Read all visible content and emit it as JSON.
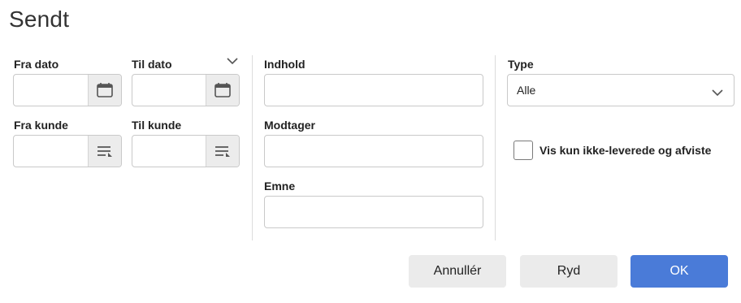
{
  "dialog": {
    "title": "Sendt"
  },
  "filters": {
    "from_date": {
      "label": "Fra dato",
      "value": "",
      "icon": "calendar-icon"
    },
    "to_date": {
      "label": "Til dato",
      "value": "",
      "icon": "calendar-icon"
    },
    "from_customer": {
      "label": "Fra kunde",
      "value": "",
      "icon": "list-lookup-icon"
    },
    "to_customer": {
      "label": "Til kunde",
      "value": "",
      "icon": "list-lookup-icon"
    },
    "content": {
      "label": "Indhold",
      "value": ""
    },
    "recipient": {
      "label": "Modtager",
      "value": ""
    },
    "subject": {
      "label": "Emne",
      "value": ""
    },
    "type": {
      "label": "Type",
      "selected": "Alle"
    },
    "undelivered_only": {
      "label": "Vis kun ikke-leverede og afviste",
      "checked": false
    }
  },
  "buttons": {
    "cancel": "Annullér",
    "clear": "Ryd",
    "ok": "OK"
  },
  "colors": {
    "primary": "#4a7bd8",
    "addon_bg": "#ececec",
    "border": "#c9c9c9"
  }
}
